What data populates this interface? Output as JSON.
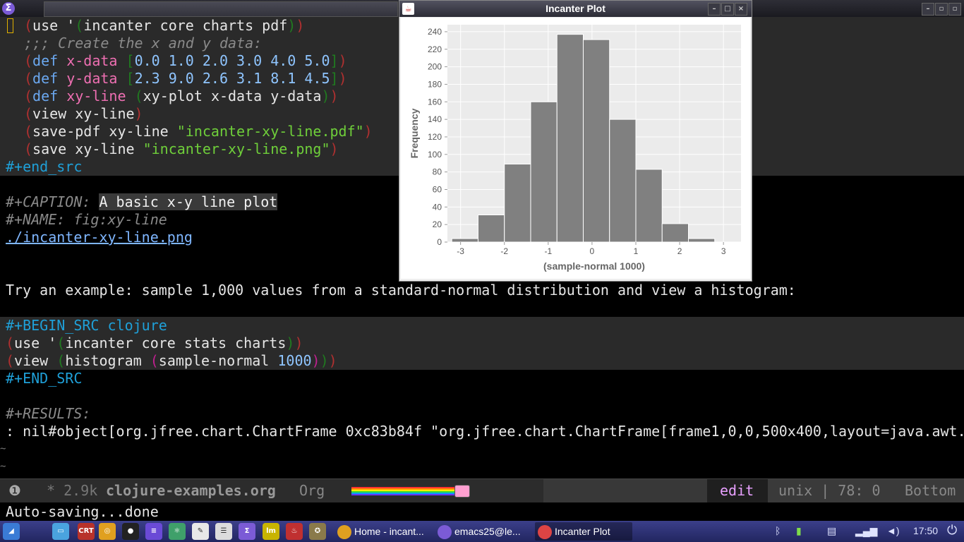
{
  "window": {
    "title_icon": "emacs-icon",
    "minimize_label": "–",
    "maximize_label": "▫",
    "close_label": "▫"
  },
  "editor": {
    "block1": [
      {
        "parts": [
          [
            "c-paren1",
            "("
          ],
          [
            "c-text",
            "use '"
          ],
          [
            "c-paren2",
            "("
          ],
          [
            "c-text",
            "incanter core charts pdf"
          ],
          [
            "c-paren2",
            ")"
          ],
          [
            "c-paren1",
            ")"
          ]
        ]
      },
      {
        "parts": [
          [
            "c-comment",
            ";;; Create the x and y data:"
          ]
        ]
      },
      {
        "parts": [
          [
            "c-paren1",
            "("
          ],
          [
            "c-kw",
            "def"
          ],
          [
            "c-text",
            " "
          ],
          [
            "c-fn",
            "x-data"
          ],
          [
            "c-text",
            " "
          ],
          [
            "c-paren2",
            "["
          ],
          [
            "c-num",
            "0.0 1.0 2.0 3.0 4.0 5.0"
          ],
          [
            "c-paren2",
            "]"
          ],
          [
            "c-paren1",
            ")"
          ]
        ]
      },
      {
        "parts": [
          [
            "c-paren1",
            "("
          ],
          [
            "c-kw",
            "def"
          ],
          [
            "c-text",
            " "
          ],
          [
            "c-fn",
            "y-data"
          ],
          [
            "c-text",
            " "
          ],
          [
            "c-paren2",
            "["
          ],
          [
            "c-num",
            "2.3 9.0 2.6 3.1 8.1 4.5"
          ],
          [
            "c-paren2",
            "]"
          ],
          [
            "c-paren1",
            ")"
          ]
        ]
      },
      {
        "parts": [
          [
            "c-paren1",
            "("
          ],
          [
            "c-kw",
            "def"
          ],
          [
            "c-text",
            " "
          ],
          [
            "c-fn",
            "xy-line"
          ],
          [
            "c-text",
            " "
          ],
          [
            "c-paren2",
            "("
          ],
          [
            "c-text",
            "xy-plot x-data y-data"
          ],
          [
            "c-paren2",
            ")"
          ],
          [
            "c-paren1",
            ")"
          ]
        ]
      },
      {
        "parts": [
          [
            "c-paren1",
            "("
          ],
          [
            "c-text",
            "view xy-line"
          ],
          [
            "c-paren1",
            ")"
          ]
        ]
      },
      {
        "parts": [
          [
            "c-paren1",
            "("
          ],
          [
            "c-text",
            "save-pdf xy-line "
          ],
          [
            "c-str",
            "\"incanter-xy-line.pdf\""
          ],
          [
            "c-paren1",
            ")"
          ]
        ]
      },
      {
        "parts": [
          [
            "c-paren1",
            "("
          ],
          [
            "c-text",
            "save xy-line "
          ],
          [
            "c-str",
            "\"incanter-xy-line.png\""
          ],
          [
            "c-paren1",
            ")"
          ]
        ]
      }
    ],
    "end_src_lower": "#+end_src",
    "caption_key": "#+CAPTION:",
    "caption_value": "A basic x-y line plot",
    "name_line": "#+NAME: fig:xy-line",
    "link_text": "./incanter-xy-line.png",
    "prose": "Try an example: sample 1,000 values from a standard-normal distribution and view a histogram:",
    "begin_src": "#+BEGIN_SRC clojure",
    "block2": [
      {
        "parts": [
          [
            "c-paren1",
            "("
          ],
          [
            "c-text",
            "use '"
          ],
          [
            "c-paren2",
            "("
          ],
          [
            "c-text",
            "incanter core stats charts"
          ],
          [
            "c-paren2",
            ")"
          ],
          [
            "c-paren1",
            ")"
          ]
        ]
      },
      {
        "parts": [
          [
            "c-paren1",
            "("
          ],
          [
            "c-text",
            "view "
          ],
          [
            "c-paren2",
            "("
          ],
          [
            "c-text",
            "histogram "
          ],
          [
            "c-paren3",
            "("
          ],
          [
            "c-text",
            "sample-normal "
          ],
          [
            "c-num",
            "1000"
          ],
          [
            "c-paren3",
            ")"
          ],
          [
            "c-paren2",
            ")"
          ],
          [
            "c-paren1",
            ")"
          ]
        ]
      }
    ],
    "end_src_upper": "#+END_SRC",
    "results_key": "#+RESULTS:",
    "results_value": ": nil#object[org.jfree.chart.ChartFrame 0xc83b84f \"org.jfree.chart.ChartFrame[frame1,0,0,500x400,layout=java.awt.",
    "tilde": "~"
  },
  "plot_window": {
    "title": "Incanter Plot",
    "minimize_label": "–",
    "maximize_label": "□",
    "close_label": "×"
  },
  "chart_data": {
    "type": "bar",
    "title": "",
    "xlabel": "(sample-normal 1000)",
    "ylabel": "Frequency",
    "bins": [
      {
        "from": -3.2,
        "to": -2.6,
        "value": 4
      },
      {
        "from": -2.6,
        "to": -2.0,
        "value": 31
      },
      {
        "from": -2.0,
        "to": -1.4,
        "value": 89
      },
      {
        "from": -1.4,
        "to": -0.8,
        "value": 160
      },
      {
        "from": -0.8,
        "to": -0.2,
        "value": 237
      },
      {
        "from": -0.2,
        "to": 0.4,
        "value": 231
      },
      {
        "from": 0.4,
        "to": 1.0,
        "value": 140
      },
      {
        "from": 1.0,
        "to": 1.6,
        "value": 83
      },
      {
        "from": 1.6,
        "to": 2.2,
        "value": 21
      },
      {
        "from": 2.2,
        "to": 2.8,
        "value": 4
      }
    ],
    "xlim": [
      -3.3,
      3.4
    ],
    "ylim": [
      0,
      248
    ],
    "xticks": [
      -3,
      -2,
      -1,
      0,
      1,
      2,
      3
    ],
    "yticks": [
      0,
      20,
      40,
      60,
      80,
      100,
      120,
      140,
      160,
      180,
      200,
      220,
      240
    ],
    "grid": true,
    "bar_color": "#808080",
    "plot_bg": "#ebebeb"
  },
  "modeline": {
    "info_icon": "❶",
    "modified": "* 2.9k",
    "buffer_name": "clojure-examples.org",
    "mode": "Org",
    "state": "edit",
    "position": "unix | 78: 0",
    "scroll": "Bottom"
  },
  "echo_area": "Auto-saving...done",
  "taskbar": {
    "launchers": [
      {
        "name": "start-menu-icon",
        "label": "◢",
        "color": "#3a7bd5"
      },
      {
        "name": "file-manager-icon",
        "label": "▭",
        "color": "#4aa3df"
      },
      {
        "name": "crt-terminal-icon",
        "label": "CRT",
        "color": "#b8322a"
      },
      {
        "name": "chrome-icon",
        "label": "◎",
        "color": "#e0a020"
      },
      {
        "name": "obs-icon",
        "label": "●",
        "color": "#222222"
      },
      {
        "name": "workspaces-icon",
        "label": "≡",
        "color": "#6a4ad6"
      },
      {
        "name": "atom-icon",
        "label": "⚛",
        "color": "#3fa06a"
      },
      {
        "name": "notes-icon",
        "label": "✎",
        "color": "#e8e8e8"
      },
      {
        "name": "document-icon",
        "label": "☰",
        "color": "#dcdcdc"
      },
      {
        "name": "emacs-launcher-icon",
        "label": "Σ",
        "color": "#7b5bd6"
      },
      {
        "name": "lm-icon",
        "label": "lm",
        "color": "#c8b400"
      },
      {
        "name": "fire-icon",
        "label": "♨",
        "color": "#c03030"
      },
      {
        "name": "gimp-icon",
        "label": "✪",
        "color": "#8a7a4a"
      }
    ],
    "tasks": [
      {
        "name": "task-chrome",
        "label": "Home - incant...",
        "icon_color": "#e0a020"
      },
      {
        "name": "task-emacs",
        "label": "emacs25@le...",
        "icon_color": "#7b5bd6"
      },
      {
        "name": "task-incanter-plot",
        "label": "Incanter Plot",
        "icon_color": "#d44"
      }
    ],
    "tray": {
      "bluetooth": "ᛒ",
      "battery": "▮",
      "clipboard": "▤",
      "signal": "▂▄▆",
      "volume": "◄)",
      "time": "17:50",
      "power": "⏻"
    }
  }
}
